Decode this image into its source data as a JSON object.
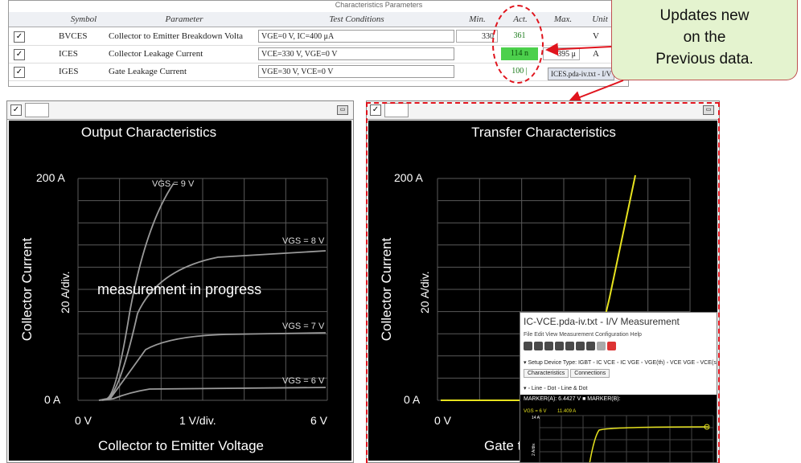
{
  "param_table": {
    "title": "Characteristics Parameters",
    "headers": {
      "symbol": "Symbol",
      "parameter": "Parameter",
      "test_conditions": "Test Conditions",
      "min": "Min.",
      "act": "Act.",
      "max": "Max.",
      "unit": "Unit"
    },
    "rows": [
      {
        "symbol": "BVCES",
        "parameter": "Collector to Emitter Breakdown Volta",
        "conditions": "VGE=0 V, IC=400 μA",
        "min": "330",
        "act": "361",
        "max": "",
        "unit": "V",
        "checked": "✓"
      },
      {
        "symbol": "ICES",
        "parameter": "Collector Leakage Current",
        "conditions": "VCE=330 V, VGE=0 V",
        "min": "",
        "act": "114 n",
        "max": "395 μ",
        "unit": "A",
        "checked": "✓"
      },
      {
        "symbol": "IGES",
        "parameter": "Gate Leakage Current",
        "conditions": "VGE=30 V, VCE=0 V",
        "min": "",
        "act": "100 |",
        "max": "",
        "unit": "",
        "checked": "✓"
      }
    ],
    "tooltip": "ICES.pda-iv.txt - I/V"
  },
  "callout": {
    "line1": "Updates new",
    "line2": "on the",
    "line3": "Previous data."
  },
  "output_panel": {
    "title": "Output Characteristics",
    "ylabel": "Collector Current",
    "xlabel": "Collector to Emitter Voltage",
    "y_top": "200  A",
    "y_bottom": "0  A",
    "y_div": "20  A/div.",
    "x_left": "0  V",
    "x_mid": "1  V/div.",
    "x_right": "6  V",
    "overlay": "measurement in progress",
    "curve_labels": [
      "VGS = 9 V",
      "VGS = 8 V",
      "VGS = 7 V",
      "VGS = 6 V"
    ],
    "checked": "✓"
  },
  "transfer_panel": {
    "title": "Transfer Characteristics",
    "ylabel": "Collector Current",
    "xlabel": "Gate t",
    "y_top": "200  A",
    "y_bottom": "0  A",
    "y_div": "20  A/div.",
    "x_left": "0  V",
    "checked": "✓"
  },
  "inset_window": {
    "title": "IC-VCE.pda-iv.txt - I/V Measurement",
    "menu": "File  Edit  View  Measurement  Configuration  Help",
    "setup": "▾ Setup  Device Type:  IGBT    ◦ IC VCE  ◦ IC VGE  ◦ VGE(th)  ◦ VCE VGE  ◦ VCE(sat)",
    "tabs": [
      "Characteristics",
      "Connections"
    ],
    "line_opts": "▾ ◦ Line  ◦ Dot  ◦ Line & Dot",
    "markers": "MARKER(A): 6.4427 V     ■ MARKER(B):",
    "vgs_label": "VGS = 6 V",
    "value_label": "11.409 A",
    "y_axis_top": "14 A",
    "y_axis_div": "2 A/div."
  },
  "colors": {
    "accent_red": "#e0141d",
    "callout_bg": "#e4f3cf",
    "act_green": "#4cd04c",
    "transfer_curve": "#e6e21e",
    "curve_gray": "#9a9a9a"
  }
}
